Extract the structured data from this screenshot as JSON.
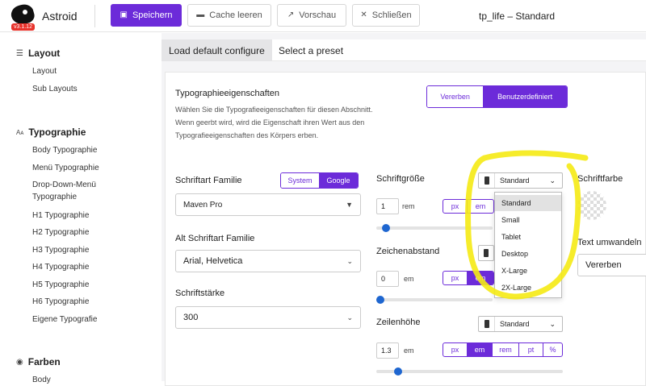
{
  "app": {
    "brand": "Astroid",
    "version": "v3.1.12",
    "window_title": "tp_life – Standard"
  },
  "toolbar": {
    "save": "Speichern",
    "cache": "Cache leeren",
    "preview": "Vorschau",
    "close": "Schließen"
  },
  "tabs": {
    "load_default": "Load default configure",
    "preset": "Select a preset"
  },
  "sidebar": {
    "layout": {
      "title": "Layout",
      "items": [
        "Layout",
        "Sub Layouts"
      ]
    },
    "typography": {
      "title": "Typographie",
      "items": [
        "Body Typographie",
        "Menü Typographie",
        "Drop-Down-Menü",
        "Typographie",
        "H1 Typographie",
        "H2 Typographie",
        "H3 Typographie",
        "H4 Typographie",
        "H5 Typographie",
        "H6 Typographie",
        "Eigene Typografie"
      ]
    },
    "colors": {
      "title": "Farben",
      "items": [
        "Body"
      ]
    }
  },
  "section": {
    "title": "Typographieeigenschaften",
    "desc": [
      "Wählen Sie die Typografieeigenschaften für diesen Abschnitt.",
      "Wenn geerbt wird, wird die Eigenschaft ihren Wert aus den",
      "Typografieeigenschaften des Körpers erben."
    ],
    "inherit": "Vererben",
    "custom": "Benutzerdefiniert"
  },
  "font": {
    "family_label": "Schriftart Familie",
    "system": "System",
    "google": "Google",
    "family_value": "Maven Pro",
    "alt_label": "Alt Schriftart Familie",
    "alt_value": "Arial, Helvetica",
    "weight_label": "Schriftstärke",
    "weight_value": "300"
  },
  "size": {
    "label": "Schriftgröße",
    "device": "Standard",
    "value": "1",
    "unit": "rem",
    "units": [
      "px",
      "em"
    ],
    "slider": 0.05
  },
  "spacing": {
    "label": "Zeichenabstand",
    "value": "0",
    "unit": "em",
    "units": [
      "px",
      "em"
    ],
    "slider": 0.0
  },
  "lineheight": {
    "label": "Zeilenhöhe",
    "device": "Standard",
    "value": "1.3",
    "unit": "em",
    "units": [
      "px",
      "em",
      "rem",
      "pt",
      "%"
    ],
    "slider": 0.1
  },
  "dropdown_options": [
    "Standard",
    "Small",
    "Tablet",
    "Desktop",
    "X-Large",
    "2X-Large"
  ],
  "color": {
    "label": "Schriftfarbe"
  },
  "transform": {
    "label": "Text umwandeln",
    "value": "Vererben"
  },
  "colors": {
    "accent": "#6c2bd9",
    "annotation": "#f5ea14",
    "slider": "#1e66d0"
  }
}
